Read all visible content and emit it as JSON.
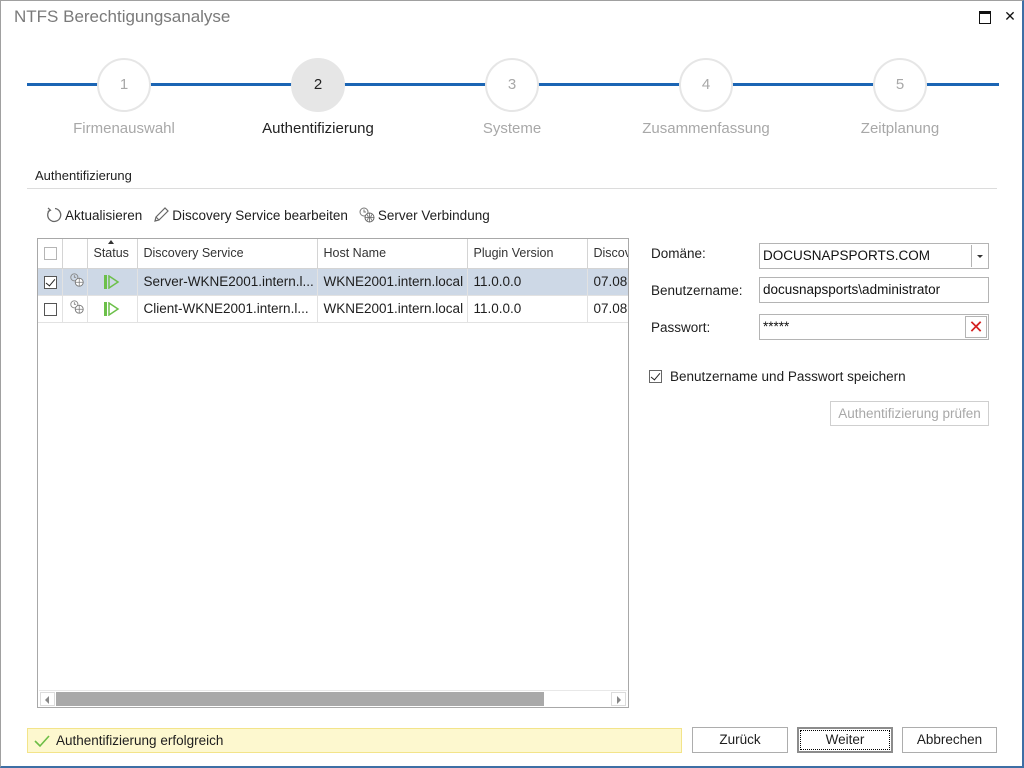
{
  "window": {
    "title": "NTFS Berechtigungsanalyse",
    "controls": {
      "maximize": "maximize",
      "close": "✕"
    }
  },
  "stepper": {
    "accent_color": "#1b65b4",
    "current_step": 2,
    "steps": [
      {
        "number": "1",
        "label": "Firmenauswahl"
      },
      {
        "number": "2",
        "label": "Authentifizierung"
      },
      {
        "number": "3",
        "label": "Systeme"
      },
      {
        "number": "4",
        "label": "Zusammenfassung"
      },
      {
        "number": "5",
        "label": "Zeitplanung"
      }
    ]
  },
  "section": {
    "title": "Authentifizierung"
  },
  "toolbar": {
    "refresh_label": "Aktualisieren",
    "edit_label": "Discovery Service bearbeiten",
    "connection_label": "Server Verbindung"
  },
  "grid": {
    "columns": [
      "",
      "",
      "Status",
      "Discovery Service",
      "Host Name",
      "Plugin Version",
      "Discov"
    ],
    "sorted_column": "Status",
    "rows": [
      {
        "checked": true,
        "selected": true,
        "status": "running",
        "service": "Server-WKNE2001.intern.l...",
        "host": "WKNE2001.intern.local",
        "version": "11.0.0.0",
        "discovery": "07.08"
      },
      {
        "checked": false,
        "selected": false,
        "status": "running",
        "service": "Client-WKNE2001.intern.l...",
        "host": "WKNE2001.intern.local",
        "version": "11.0.0.0",
        "discovery": "07.08"
      }
    ]
  },
  "form": {
    "domain_label": "Domäne:",
    "domain_value": "DOCUSNAPSPORTS.COM",
    "username_label": "Benutzername:",
    "username_value": "docusnapsports\\administrator",
    "password_label": "Passwort:",
    "password_value": "*****",
    "save_credentials_label": "Benutzername und Passwort speichern",
    "save_credentials_checked": true,
    "verify_button": "Authentifizierung prüfen"
  },
  "status": {
    "message": "Authentifizierung erfolgreich",
    "state": "success",
    "background": "#fdf8cf"
  },
  "footer": {
    "back_label": "Zurück",
    "next_label": "Weiter",
    "cancel_label": "Abbrechen"
  }
}
